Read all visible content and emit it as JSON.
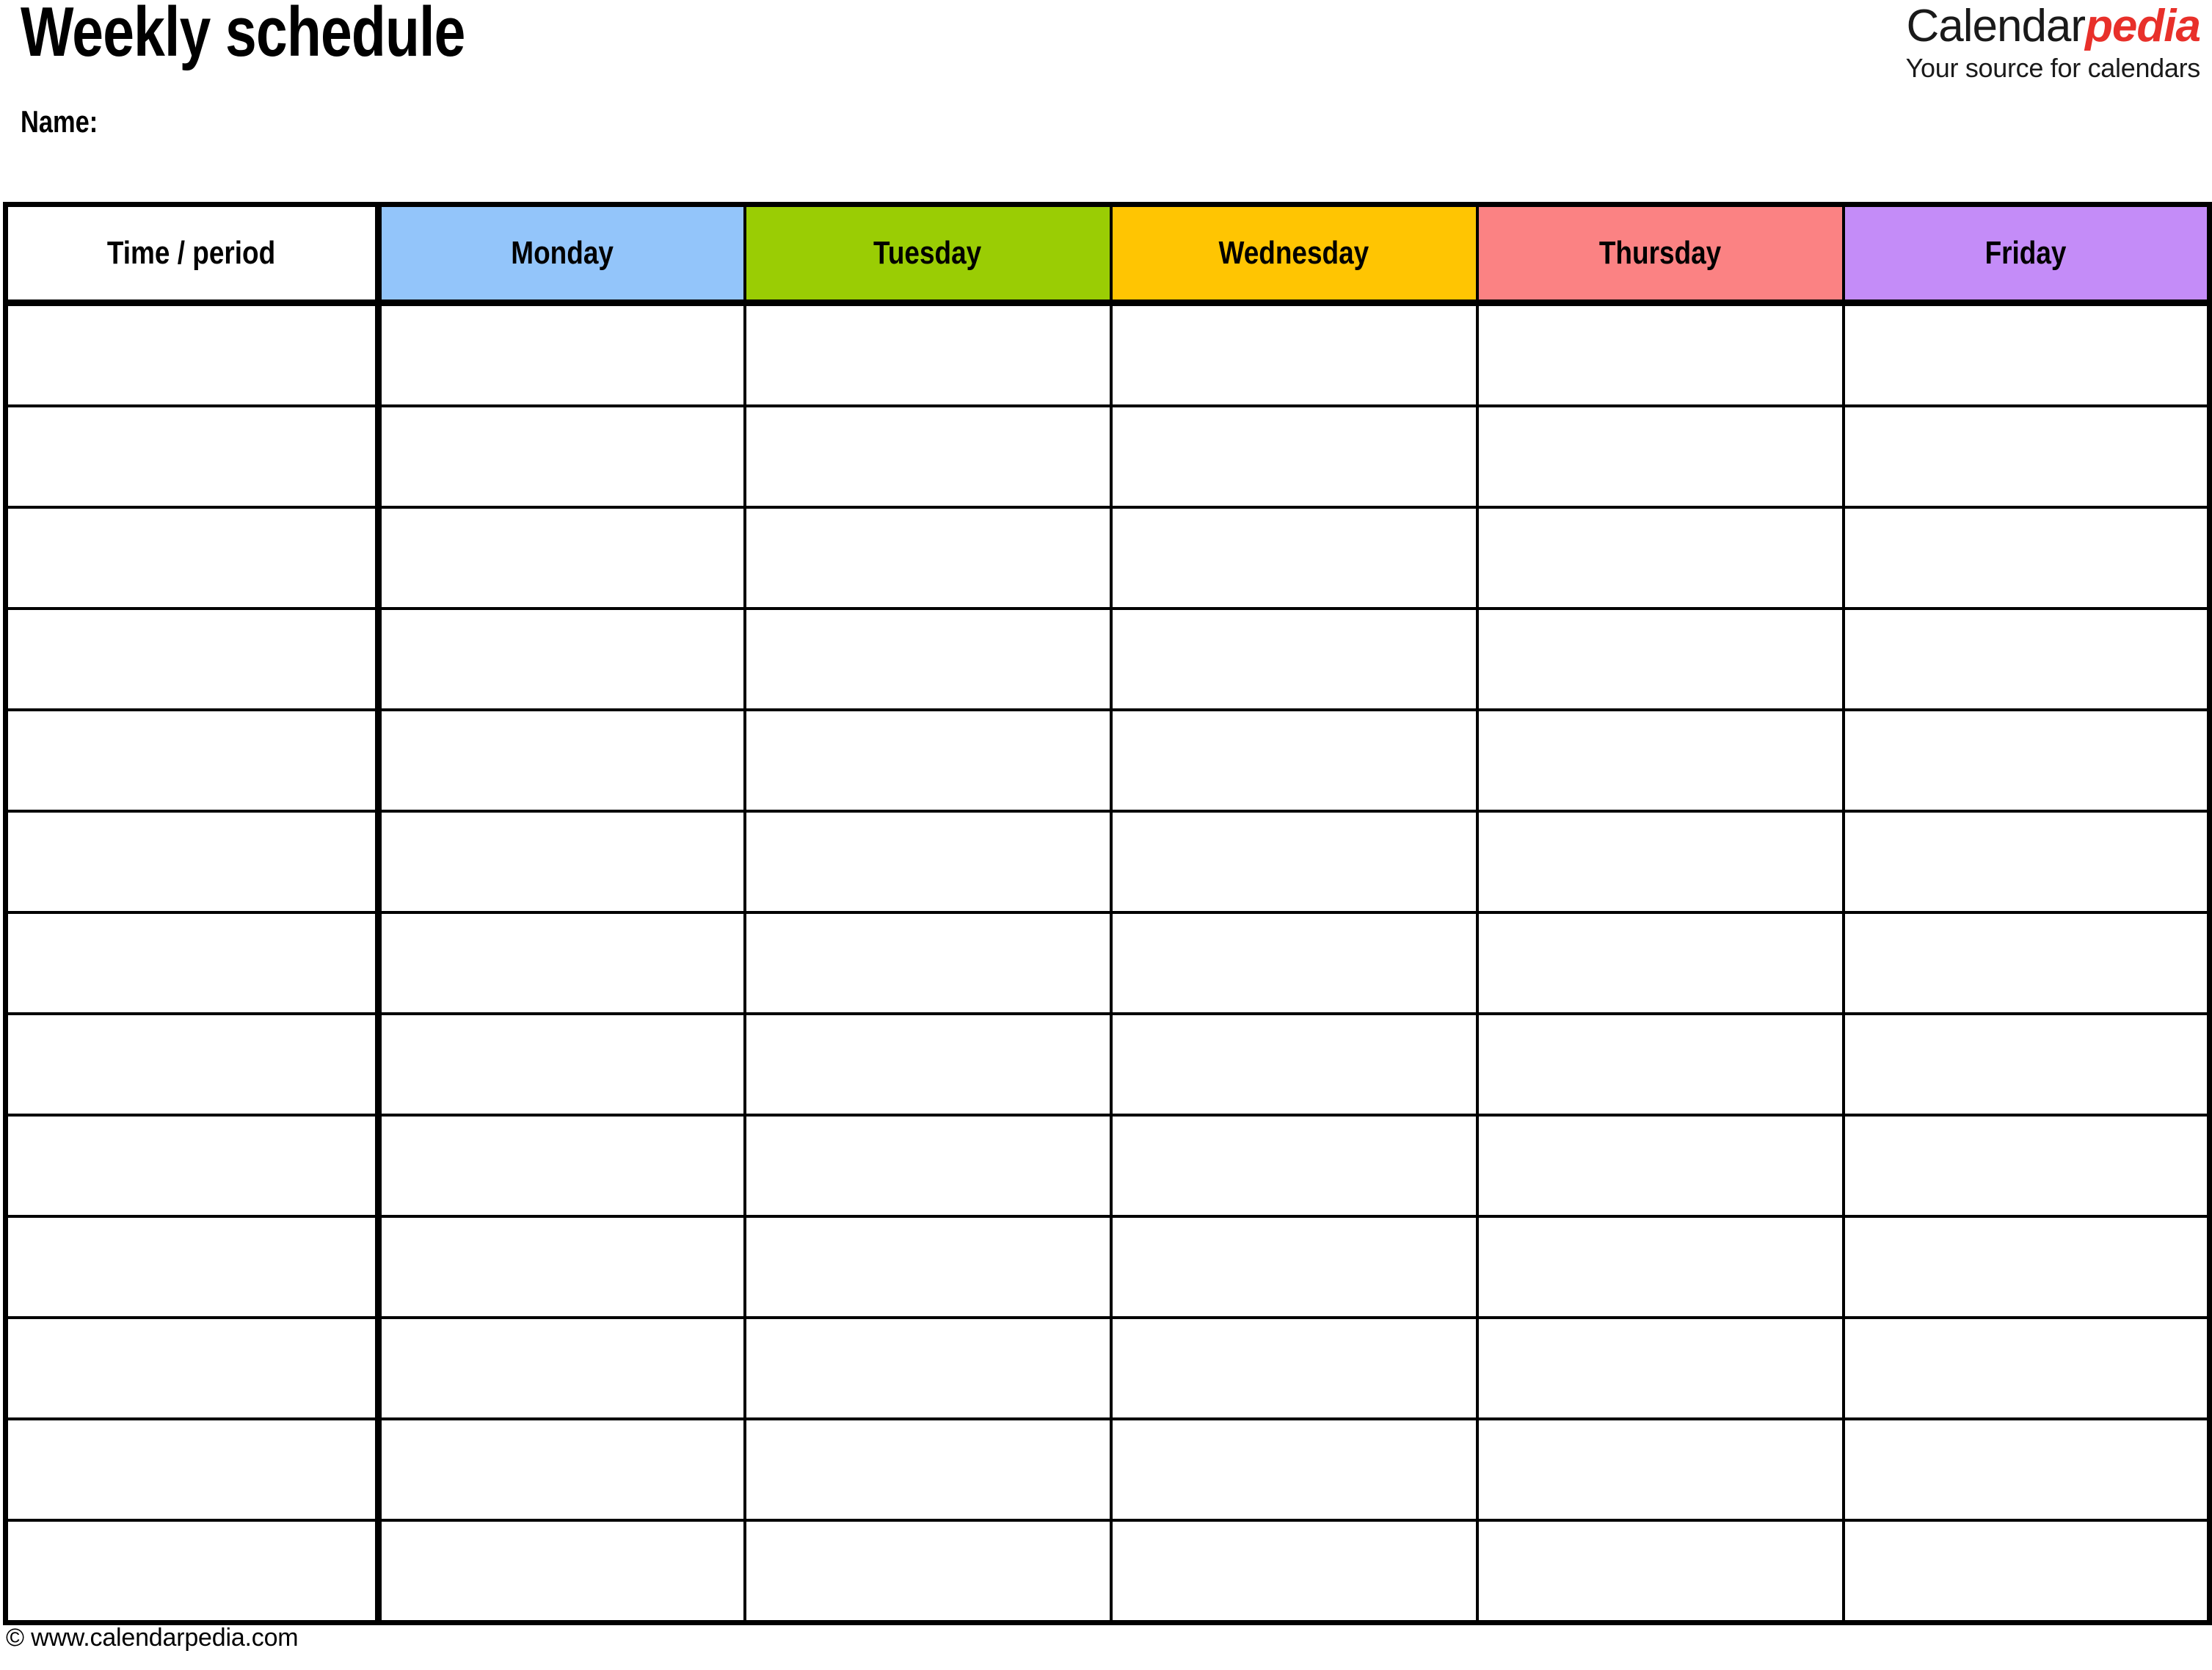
{
  "document": {
    "title": "Weekly schedule",
    "name_label": "Name:"
  },
  "brand": {
    "name_part1": "Calendar",
    "name_part2": "pedia",
    "tagline": "Your source for calendars",
    "accent_color": "#E8302A",
    "text_color": "#1a1a1a"
  },
  "footer": {
    "copyright": "© www.calendarpedia.com"
  },
  "table": {
    "columns": [
      {
        "label": "Time / period",
        "color": "#FFFFFF",
        "key": "time"
      },
      {
        "label": "Monday",
        "color": "#93C5FA",
        "key": "monday"
      },
      {
        "label": "Tuesday",
        "color": "#9ACD04",
        "key": "tuesday"
      },
      {
        "label": "Wednesday",
        "color": "#FFC502",
        "key": "wednesday"
      },
      {
        "label": "Thursday",
        "color": "#FB8283",
        "key": "thursday"
      },
      {
        "label": "Friday",
        "color": "#C48CF8",
        "key": "friday"
      }
    ],
    "row_count": 13,
    "rows": [
      {
        "time": "",
        "monday": "",
        "tuesday": "",
        "wednesday": "",
        "thursday": "",
        "friday": ""
      },
      {
        "time": "",
        "monday": "",
        "tuesday": "",
        "wednesday": "",
        "thursday": "",
        "friday": ""
      },
      {
        "time": "",
        "monday": "",
        "tuesday": "",
        "wednesday": "",
        "thursday": "",
        "friday": ""
      },
      {
        "time": "",
        "monday": "",
        "tuesday": "",
        "wednesday": "",
        "thursday": "",
        "friday": ""
      },
      {
        "time": "",
        "monday": "",
        "tuesday": "",
        "wednesday": "",
        "thursday": "",
        "friday": ""
      },
      {
        "time": "",
        "monday": "",
        "tuesday": "",
        "wednesday": "",
        "thursday": "",
        "friday": ""
      },
      {
        "time": "",
        "monday": "",
        "tuesday": "",
        "wednesday": "",
        "thursday": "",
        "friday": ""
      },
      {
        "time": "",
        "monday": "",
        "tuesday": "",
        "wednesday": "",
        "thursday": "",
        "friday": ""
      },
      {
        "time": "",
        "monday": "",
        "tuesday": "",
        "wednesday": "",
        "thursday": "",
        "friday": ""
      },
      {
        "time": "",
        "monday": "",
        "tuesday": "",
        "wednesday": "",
        "thursday": "",
        "friday": ""
      },
      {
        "time": "",
        "monday": "",
        "tuesday": "",
        "wednesday": "",
        "thursday": "",
        "friday": ""
      },
      {
        "time": "",
        "monday": "",
        "tuesday": "",
        "wednesday": "",
        "thursday": "",
        "friday": ""
      },
      {
        "time": "",
        "monday": "",
        "tuesday": "",
        "wednesday": "",
        "thursday": "",
        "friday": ""
      }
    ]
  }
}
